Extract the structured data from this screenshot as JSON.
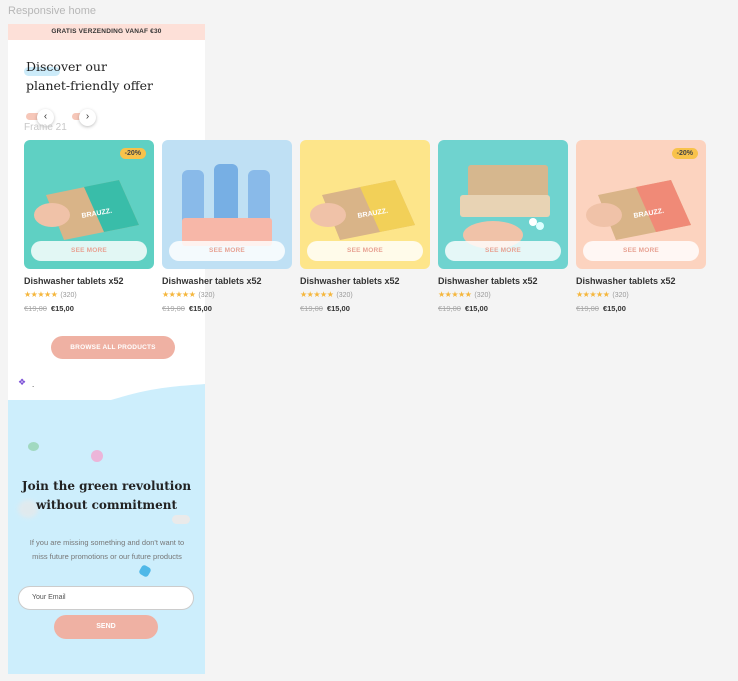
{
  "frame": {
    "title": "Responsive home",
    "inner_frame_label": "Frame 21"
  },
  "promo_bar": {
    "text": "GRATIS VERZENDING VANAF €30"
  },
  "hero": {
    "title_line1": "Discover our",
    "title_line2": "planet-friendly offer"
  },
  "carousel": {
    "prev_icon": "‹",
    "next_icon": "›"
  },
  "products": [
    {
      "name": "Dishwasher tablets x52",
      "badge": "-20%",
      "reviews": "(320)",
      "old_price": "€19,00",
      "new_price": "€15,00",
      "see_more": "SEE MORE",
      "bg": "#5fd0c3",
      "box": "teal"
    },
    {
      "name": "Dishwasher tablets x52",
      "badge": "",
      "reviews": "(320)",
      "old_price": "€19,00",
      "new_price": "€15,00",
      "see_more": "SEE MORE",
      "bg": "#bfe0f4",
      "box": "bottles"
    },
    {
      "name": "Dishwasher tablets x52",
      "badge": "",
      "reviews": "(320)",
      "old_price": "€19,00",
      "new_price": "€15,00",
      "see_more": "SEE MORE",
      "bg": "#fde58a",
      "box": "yellow"
    },
    {
      "name": "Dishwasher tablets x52",
      "badge": "",
      "reviews": "(320)",
      "old_price": "€19,00",
      "new_price": "€15,00",
      "see_more": "SEE MORE",
      "bg": "#6fd3cf",
      "box": "open"
    },
    {
      "name": "Dishwasher tablets x52",
      "badge": "-20%",
      "reviews": "(320)",
      "old_price": "€19,00",
      "new_price": "€15,00",
      "see_more": "SEE MORE",
      "bg": "#fcd3bf",
      "box": "coral"
    }
  ],
  "rating": {
    "stars": "★★★★★",
    "value": 5
  },
  "browse": {
    "label": "BROWSE ALL PRODUCTS"
  },
  "component_marker": {
    "icon": "❖",
    "text": "."
  },
  "newsletter": {
    "title_line1": "Join the green revolution",
    "title_line2": "without commitment",
    "text": "If you are missing something and don't want to miss future promotions or our future products",
    "email_placeholder": "Your Email",
    "send_label": "SEND"
  },
  "colors": {
    "accent": "#efb1a3",
    "promo_bg": "#fde0d8",
    "news_bg": "#cdeefc",
    "star": "#f5b63c",
    "badge": "#f8c24a"
  }
}
